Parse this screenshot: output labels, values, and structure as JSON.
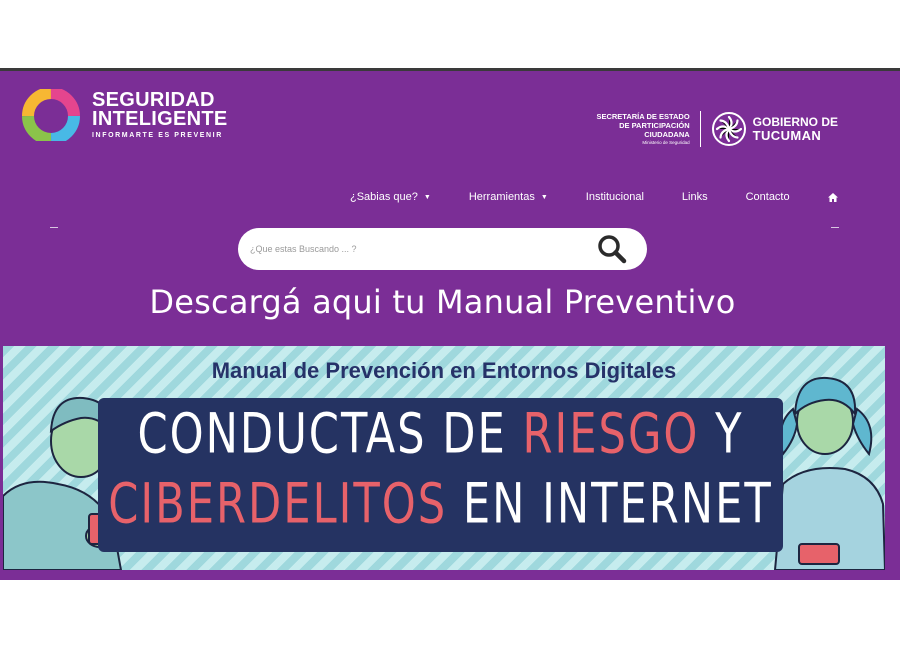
{
  "brand": {
    "line1": "SEGURIDAD",
    "line2": "INTELIGENTE",
    "tagline": "INFORMARTE ES PREVENIR"
  },
  "gov": {
    "sec_line1": "SECRETARÍA DE ESTADO",
    "sec_line2": "DE PARTICIPACIÓN",
    "sec_line3": "CIUDADANA",
    "sec_line4": "Ministerio de Seguridad",
    "name_line1": "GOBIERNO DE",
    "name_line2": "TUCUMAN"
  },
  "nav": {
    "items": [
      {
        "label": "¿Sabias que?",
        "has_dropdown": true
      },
      {
        "label": "Herramientas",
        "has_dropdown": true
      },
      {
        "label": "Institucional",
        "has_dropdown": false
      },
      {
        "label": "Links",
        "has_dropdown": false
      },
      {
        "label": "Contacto",
        "has_dropdown": false
      }
    ],
    "home_icon": "home-icon"
  },
  "search": {
    "placeholder": "¿Que estas Buscando ... ?",
    "icon": "search-icon"
  },
  "headline": "Descargá aqui tu Manual Preventivo",
  "banner": {
    "title": "Manual de Prevención en Entornos Digitales",
    "line1_a": "CONDUCTAS DE ",
    "line1_b": "RIESGO",
    "line1_c": " Y",
    "line2_a": "CIBERDELITOS",
    "line2_b": " EN INTERNET"
  },
  "colors": {
    "site_bg": "#7b2e96",
    "band_bg": "#253362",
    "accent_red": "#e7626a",
    "stripe_light": "#c6ecee",
    "stripe_dark": "#9fd8dd"
  }
}
